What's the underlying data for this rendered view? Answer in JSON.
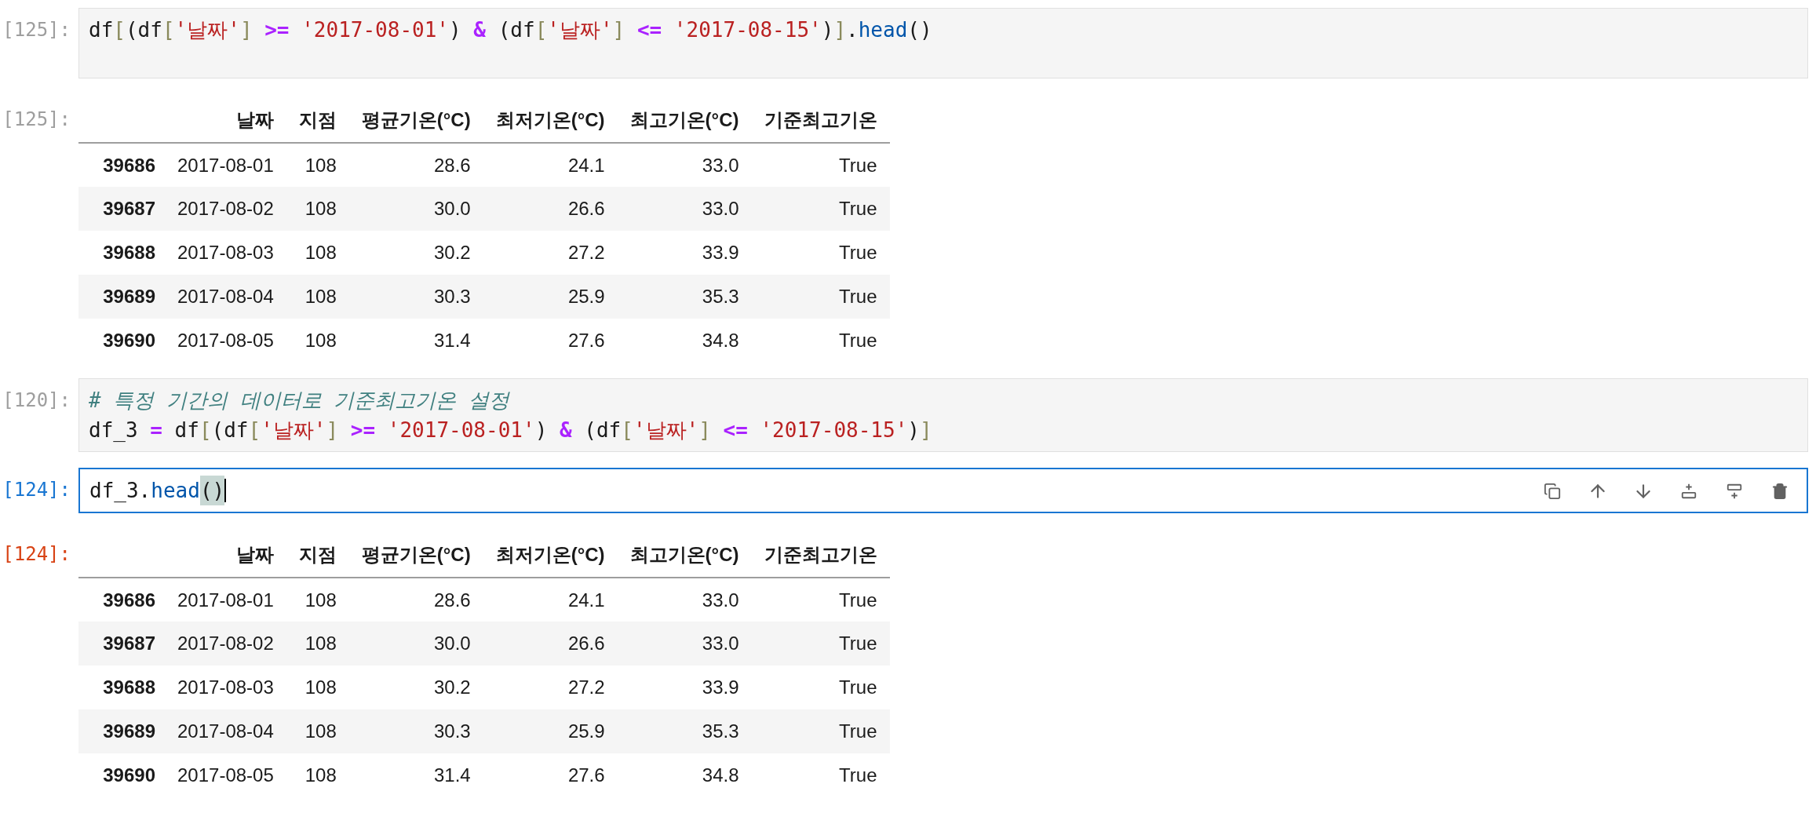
{
  "cells": [
    {
      "kind": "code",
      "prompt": "[125]:",
      "selected": false,
      "lines": [
        [
          {
            "t": "df",
            "kind": "plain"
          },
          {
            "t": "[",
            "kind": "bracket"
          },
          {
            "t": "(df",
            "kind": "plain"
          },
          {
            "t": "[",
            "kind": "bracket"
          },
          {
            "t": "'날짜'",
            "kind": "string"
          },
          {
            "t": "]",
            "kind": "bracket"
          },
          {
            "t": " >=",
            "kind": "op"
          },
          {
            "t": " '2017-08-01'",
            "kind": "string"
          },
          {
            "t": ") ",
            "kind": "plain"
          },
          {
            "t": "&",
            "kind": "op"
          },
          {
            "t": " (df",
            "kind": "plain"
          },
          {
            "t": "[",
            "kind": "bracket"
          },
          {
            "t": "'날짜'",
            "kind": "string"
          },
          {
            "t": "]",
            "kind": "bracket"
          },
          {
            "t": " <=",
            "kind": "op"
          },
          {
            "t": " '2017-08-15'",
            "kind": "string"
          },
          {
            "t": ")",
            "kind": "plain"
          },
          {
            "t": "]",
            "kind": "bracket"
          },
          {
            "t": ".",
            "kind": "plain"
          },
          {
            "t": "head",
            "kind": "func"
          },
          {
            "t": "()",
            "kind": "plain"
          }
        ]
      ]
    },
    {
      "kind": "output",
      "prompt": "[125]:",
      "active": false,
      "columns": [
        "날짜",
        "지점",
        "평균기온(°C)",
        "최저기온(°C)",
        "최고기온(°C)",
        "기준최고기온"
      ],
      "rows": [
        {
          "index": "39686",
          "cells": [
            "2017-08-01",
            "108",
            "28.6",
            "24.1",
            "33.0",
            "True"
          ]
        },
        {
          "index": "39687",
          "cells": [
            "2017-08-02",
            "108",
            "30.0",
            "26.6",
            "33.0",
            "True"
          ]
        },
        {
          "index": "39688",
          "cells": [
            "2017-08-03",
            "108",
            "30.2",
            "27.2",
            "33.9",
            "True"
          ]
        },
        {
          "index": "39689",
          "cells": [
            "2017-08-04",
            "108",
            "30.3",
            "25.9",
            "35.3",
            "True"
          ]
        },
        {
          "index": "39690",
          "cells": [
            "2017-08-05",
            "108",
            "31.4",
            "27.6",
            "34.8",
            "True"
          ]
        }
      ]
    },
    {
      "kind": "code",
      "prompt": "[120]:",
      "selected": false,
      "lines": [
        [
          {
            "t": "# 특정 기간의 데이터로 기준최고기온 설정",
            "kind": "comment"
          }
        ],
        [
          {
            "t": "df_3",
            "kind": "plain"
          },
          {
            "t": " =",
            "kind": "op"
          },
          {
            "t": " df",
            "kind": "plain"
          },
          {
            "t": "[",
            "kind": "bracket"
          },
          {
            "t": "(df",
            "kind": "plain"
          },
          {
            "t": "[",
            "kind": "bracket"
          },
          {
            "t": "'날짜'",
            "kind": "string"
          },
          {
            "t": "]",
            "kind": "bracket"
          },
          {
            "t": " >=",
            "kind": "op"
          },
          {
            "t": " '2017-08-01'",
            "kind": "string"
          },
          {
            "t": ") ",
            "kind": "plain"
          },
          {
            "t": "&",
            "kind": "op"
          },
          {
            "t": " (df",
            "kind": "plain"
          },
          {
            "t": "[",
            "kind": "bracket"
          },
          {
            "t": "'날짜'",
            "kind": "string"
          },
          {
            "t": "]",
            "kind": "bracket"
          },
          {
            "t": " <=",
            "kind": "op"
          },
          {
            "t": " '2017-08-15'",
            "kind": "string"
          },
          {
            "t": ")",
            "kind": "plain"
          },
          {
            "t": "]",
            "kind": "bracket"
          }
        ]
      ]
    },
    {
      "kind": "code",
      "prompt": "[124]:",
      "selected": true,
      "lines": [
        [
          {
            "t": "df_3.",
            "kind": "plain"
          },
          {
            "t": "head",
            "kind": "func"
          },
          {
            "t": "()",
            "kind": "match"
          }
        ]
      ]
    },
    {
      "kind": "output",
      "prompt": "[124]:",
      "active": true,
      "columns": [
        "날짜",
        "지점",
        "평균기온(°C)",
        "최저기온(°C)",
        "최고기온(°C)",
        "기준최고기온"
      ],
      "rows": [
        {
          "index": "39686",
          "cells": [
            "2017-08-01",
            "108",
            "28.6",
            "24.1",
            "33.0",
            "True"
          ]
        },
        {
          "index": "39687",
          "cells": [
            "2017-08-02",
            "108",
            "30.0",
            "26.6",
            "33.0",
            "True"
          ]
        },
        {
          "index": "39688",
          "cells": [
            "2017-08-03",
            "108",
            "30.2",
            "27.2",
            "33.9",
            "True"
          ]
        },
        {
          "index": "39689",
          "cells": [
            "2017-08-04",
            "108",
            "30.3",
            "25.9",
            "35.3",
            "True"
          ]
        },
        {
          "index": "39690",
          "cells": [
            "2017-08-05",
            "108",
            "31.4",
            "27.6",
            "34.8",
            "True"
          ]
        }
      ]
    }
  ]
}
